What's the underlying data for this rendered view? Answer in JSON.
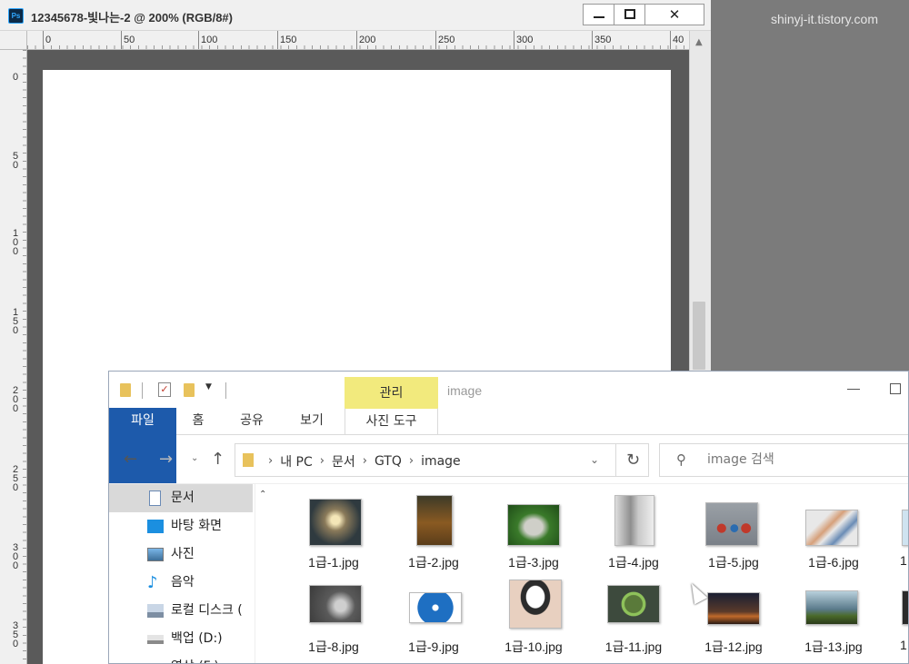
{
  "watermark": "shinyj-it.tistory.com",
  "photoshop": {
    "logo": "Ps",
    "title": "12345678-빛나는-2 @ 200% (RGB/8#)",
    "close_glyph": "✕",
    "ruler_h_labels": [
      "0",
      "50",
      "100",
      "150",
      "200",
      "250",
      "300",
      "350",
      "40"
    ],
    "ruler_v_labels": [
      [
        "0"
      ],
      [
        "5",
        "0"
      ],
      [
        "1",
        "0",
        "0"
      ],
      [
        "1",
        "5",
        "0"
      ],
      [
        "2",
        "0",
        "0"
      ],
      [
        "2",
        "5",
        "0"
      ],
      [
        "3",
        "0",
        "0"
      ],
      [
        "3",
        "5",
        "0"
      ]
    ],
    "scroll_up_glyph": "▲"
  },
  "explorer": {
    "title": "image",
    "context_tab_header": "관리",
    "ribbon_tabs": {
      "file": "파일",
      "home": "홈",
      "share": "공유",
      "view": "보기",
      "picture_tools": "사진 도구"
    },
    "nav": {
      "back": "←",
      "forward": "→",
      "recent": "⌄",
      "up": "↑",
      "refresh": "↻",
      "dropdown": "⌄"
    },
    "breadcrumb": [
      "내 PC",
      "문서",
      "GTQ",
      "image"
    ],
    "crumb_sep": "›",
    "search_placeholder": "image 검색",
    "search_icon": "⚲",
    "sidebar": [
      {
        "label": "문서",
        "icon": "documents-icon",
        "selected": true
      },
      {
        "label": "바탕 화면",
        "icon": "desktop-icon",
        "selected": false
      },
      {
        "label": "사진",
        "icon": "pictures-icon",
        "selected": false
      },
      {
        "label": "음악",
        "icon": "music-icon",
        "selected": false
      },
      {
        "label": "로컬 디스크 (",
        "icon": "local-disk-icon",
        "selected": false
      },
      {
        "label": "백업 (D:)",
        "icon": "drive-icon",
        "selected": false
      },
      {
        "label": "영상 (F:)",
        "icon": "drive-icon",
        "selected": false
      }
    ],
    "sidebar_scroll_up": "⌃",
    "files_row1": [
      "1급-1.jpg",
      "1급-2.jpg",
      "1급-3.jpg",
      "1급-4.jpg",
      "1급-5.jpg",
      "1급-6.jpg",
      "1"
    ],
    "files_row2": [
      "1급-8.jpg",
      "1급-9.jpg",
      "1급-10.jpg",
      "1급-11.jpg",
      "1급-12.jpg",
      "1급-13.jpg",
      "1"
    ]
  }
}
